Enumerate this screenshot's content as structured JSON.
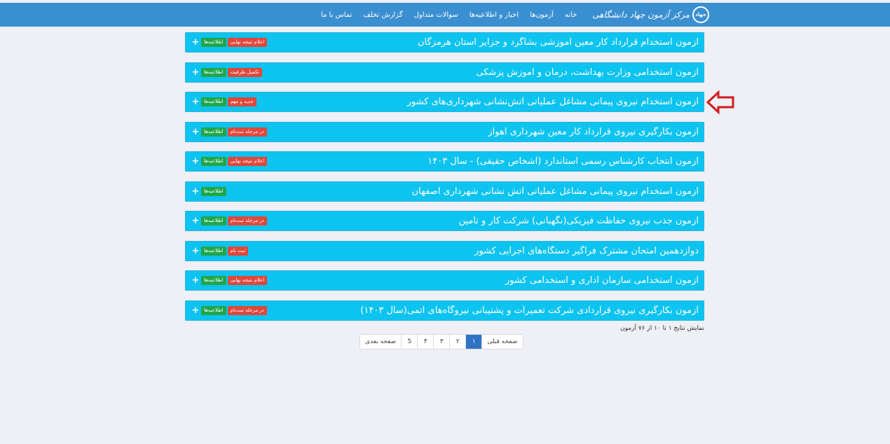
{
  "header": {
    "logo_mark": "جهاد",
    "logo_text": "مرکز آزمون جهاد دانشگاهی",
    "nav": [
      "خانه",
      "آزمون‌ها",
      "اخبار و اطلاعیه‌ها",
      "سوالات متداول",
      "گزارش تخلف",
      "تماس با ما"
    ]
  },
  "exams": [
    {
      "title": "آزمون استخدام قرارداد کار معین آموزشی بشاگرد و جزایر استان هرمزگان",
      "info_badge": "اطلاعیه‌ها",
      "status_badge": "اعلام نتیجه نهایی"
    },
    {
      "title": "آزمون استخدامی وزارت بهداشت، درمان و آموزش پزشکی",
      "info_badge": "اطلاعیه‌ها",
      "status_badge": "تکمیل ظرفیت"
    },
    {
      "title": "آزمون استخدام نیروی پیمانی مشاغل عملیاتی آتش‌نشانی شهرداری‌های کشور",
      "info_badge": "اطلاعیه‌ها",
      "status_badge": "جدید و مهم"
    },
    {
      "title": "آزمون بکارگیری نیروی قرارداد کار معین شهرداری اهواز",
      "info_badge": "اطلاعیه‌ها",
      "status_badge": "در مرحله ثبت‌نام"
    },
    {
      "title": "آزمون انتخاب کارشناس رسمی استاندارد (اشخاص حقیقی) - سال ۱۴۰۳",
      "info_badge": "اطلاعیه‌ها",
      "status_badge": "اعلام نتیجه نهایی"
    },
    {
      "title": "آزمون استخدام نیروی پیمانی مشاغل عملیاتی آتش نشانی شهرداری اصفهان",
      "info_badge": "اطلاعیه‌ها",
      "status_badge": ""
    },
    {
      "title": "آزمون جذب نیروی حفاظت فیزیکی(نگهبانی) شرکت کار و تامین",
      "info_badge": "اطلاعیه‌ها",
      "status_badge": "در مرحله ثبت‌نام"
    },
    {
      "title": "دوازدهمین امتحان مشترک فراگیر دستگاه‌های اجرایی کشور",
      "info_badge": "اطلاعیه‌ها",
      "status_badge": "ثبت نام"
    },
    {
      "title": "آزمون استخدامی سازمان اداری و استخدامی کشور",
      "info_badge": "اطلاعیه‌ها",
      "status_badge": "اعلام نتیجه نهایی"
    },
    {
      "title": "آزمون بکارگیری نیروی قراردادی شرکت تعمیرات و پشتیبانی نیروگاه‌های اتمی(سال ۱۴۰۳)",
      "info_badge": "اطلاعیه‌ها",
      "status_badge": "در مرحله ثبت‌نام"
    }
  ],
  "summary": "نمایش نتایج ۱ تا ۱۰ از ۷۶ آزمون",
  "pagination": {
    "prev": "صفحه قبلی",
    "pages": [
      "۱",
      "۲",
      "۳",
      "۴",
      "5"
    ],
    "next": "صفحه بعدی",
    "active_page": "۱"
  },
  "colors": {
    "topbar": "#3a8fd1",
    "row": "#0dc3ef",
    "badge_green": "#1fa64a",
    "badge_red": "#e0473b",
    "annotation_arrow": "#d01c1c"
  },
  "icons": {
    "expand": "plus-icon",
    "annotation": "arrow-left-outline-icon"
  }
}
